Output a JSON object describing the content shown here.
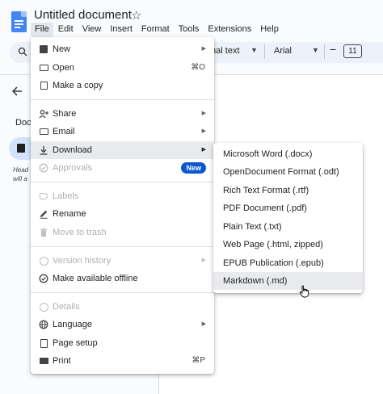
{
  "app": {
    "title": "Untitled document",
    "star": "☆",
    "menubar": [
      "File",
      "Edit",
      "View",
      "Insert",
      "Format",
      "Tools",
      "Extensions",
      "Help"
    ]
  },
  "toolbar": {
    "style_value": "mal text",
    "font_value": "Arial",
    "minus": "−",
    "font_size": "11"
  },
  "outline": {
    "title": "Doc",
    "hint": "Head will a"
  },
  "file_menu": {
    "items": [
      {
        "label": "New",
        "icon": "new-doc-icon",
        "arrow": "▶"
      },
      {
        "label": "Open",
        "icon": "folder-icon",
        "shortcut": "⌘O"
      },
      {
        "label": "Make a copy",
        "icon": "copy-icon"
      },
      {
        "label": "Share",
        "icon": "share-person-icon",
        "arrow": "▶"
      },
      {
        "label": "Email",
        "icon": "email-icon",
        "arrow": "▶"
      },
      {
        "label": "Download",
        "icon": "download-icon",
        "arrow": "▶"
      },
      {
        "label": "Approvals",
        "icon": "approvals-icon",
        "badge": "New"
      },
      {
        "label": "Labels",
        "icon": "label-icon"
      },
      {
        "label": "Rename",
        "icon": "pencil-icon"
      },
      {
        "label": "Move to trash",
        "icon": "trash-icon"
      },
      {
        "label": "Version history",
        "icon": "history-icon",
        "arrow": "▶"
      },
      {
        "label": "Make available offline",
        "icon": "offline-icon"
      },
      {
        "label": "Details",
        "icon": "info-icon"
      },
      {
        "label": "Language",
        "icon": "globe-icon",
        "arrow": "▶"
      },
      {
        "label": "Page setup",
        "icon": "page-setup-icon"
      },
      {
        "label": "Print",
        "icon": "print-icon",
        "shortcut": "⌘P"
      }
    ]
  },
  "download_menu": {
    "items": [
      "Microsoft Word (.docx)",
      "OpenDocument Format (.odt)",
      "Rich Text Format (.rtf)",
      "PDF Document (.pdf)",
      "Plain Text (.txt)",
      "Web Page (.html, zipped)",
      "EPUB Publication (.epub)",
      "Markdown (.md)"
    ]
  },
  "colors": {
    "accent": "#0b57d0",
    "hover": "#e8eaed",
    "doc_blue": "#4285f4"
  }
}
